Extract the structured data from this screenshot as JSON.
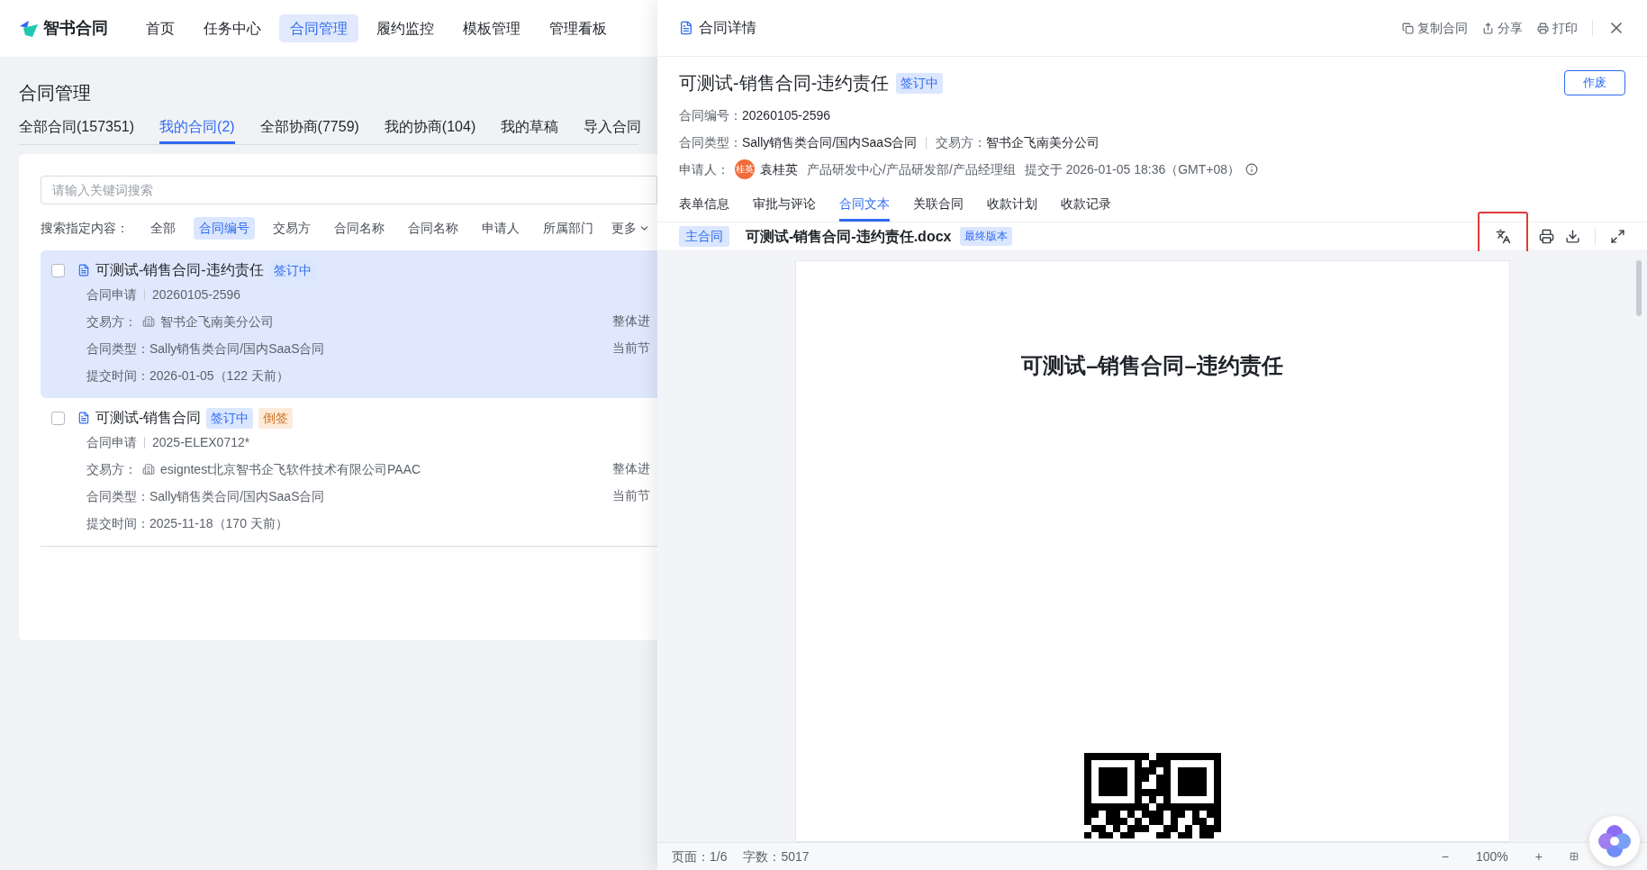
{
  "app": {
    "logo": "智书合同",
    "nav": [
      {
        "label": "首页",
        "selected": false
      },
      {
        "label": "任务中心",
        "selected": false
      },
      {
        "label": "合同管理",
        "selected": true
      },
      {
        "label": "履约监控",
        "selected": false
      },
      {
        "label": "模板管理",
        "selected": false
      },
      {
        "label": "管理看板",
        "selected": false
      }
    ]
  },
  "page": {
    "title": "合同管理",
    "tabs": [
      {
        "label": "全部合同(157351)",
        "selected": false
      },
      {
        "label": "我的合同(2)",
        "selected": true
      },
      {
        "label": "全部协商(7759)",
        "selected": false
      },
      {
        "label": "我的协商(104)",
        "selected": false
      },
      {
        "label": "我的草稿",
        "selected": false
      },
      {
        "label": "导入合同",
        "selected": false
      }
    ],
    "search": {
      "placeholder": "请输入关键词搜索"
    },
    "filter": {
      "label": "搜索指定内容：",
      "more": "更多",
      "options": [
        {
          "label": "全部",
          "selected": false
        },
        {
          "label": "合同编号",
          "selected": true
        },
        {
          "label": "交易方",
          "selected": false
        },
        {
          "label": "合同名称",
          "selected": false
        },
        {
          "label": "合同名称",
          "selected": false
        },
        {
          "label": "申请人",
          "selected": false
        },
        {
          "label": "所属部门",
          "selected": false
        }
      ]
    },
    "contracts": [
      {
        "selected": true,
        "checked": false,
        "title": "可测试-销售合同-违约责任",
        "tags": [
          {
            "label": "签订中",
            "kind": "status"
          }
        ],
        "number_label": "合同申请",
        "number": "20260105-2596",
        "party_label": "交易方：",
        "party": "智书企飞南美分公司",
        "type_label": "合同类型：",
        "type": "Sally销售类合同/国内SaaS合同",
        "time_label": "提交时间：",
        "time": "2026-01-05（122 天前）",
        "progress_label": "整体进",
        "node_label": "当前节"
      },
      {
        "selected": false,
        "checked": false,
        "title": "可测试-销售合同",
        "tags": [
          {
            "label": "签订中",
            "kind": "status"
          },
          {
            "label": "倒签",
            "kind": "warning"
          }
        ],
        "number_label": "合同申请",
        "number": "2025-ELEX0712*",
        "party_label": "交易方：",
        "party": "esigntest北京智书企飞软件技术有限公司PAAC",
        "type_label": "合同类型：",
        "type": "Sally销售类合同/国内SaaS合同",
        "time_label": "提交时间：",
        "time": "2025-11-18（170 天前）",
        "progress_label": "整体进",
        "node_label": "当前节"
      }
    ]
  },
  "detail": {
    "header": "合同详情",
    "actions": [
      {
        "label": "复制合同",
        "kind": "copy"
      },
      {
        "label": "分享",
        "kind": "share"
      },
      {
        "label": "打印",
        "kind": "print"
      }
    ],
    "title": "可测试-销售合同-违约责任",
    "status": "签订中",
    "void_button": "作废",
    "number_label": "合同编号：",
    "number": "20260105-2596",
    "type_label": "合同类型：",
    "type": "Sally销售类合同/国内SaaS合同",
    "party_label": "交易方：",
    "party": "智书企飞南美分公司",
    "applicant_label": "申请人：",
    "avatar": "桂英",
    "applicant": "袁桂英",
    "department": "产品研发中心/产品研发部/产品经理组",
    "submitted": "提交于 2026-01-05 18:36（GMT+08）",
    "tabs": [
      {
        "label": "表单信息",
        "selected": false
      },
      {
        "label": "审批与评论",
        "selected": false
      },
      {
        "label": "合同文本",
        "selected": true
      },
      {
        "label": "关联合同",
        "selected": false
      },
      {
        "label": "收款计划",
        "selected": false
      },
      {
        "label": "收款记录",
        "selected": false
      }
    ],
    "doc": {
      "main_tag": "主合同",
      "filename": "可测试-销售合同-违约责任.docx",
      "version": "最终版本",
      "heading": "可测试–销售合同–违约责任"
    },
    "status_bar": {
      "page": "页面：1/6",
      "words": "字数：5017",
      "minus": "−",
      "zoom": "100%",
      "plus": "+"
    }
  }
}
